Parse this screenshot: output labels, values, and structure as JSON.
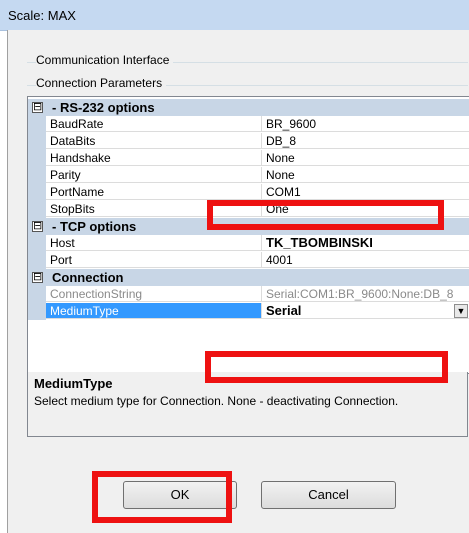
{
  "window": {
    "title": "Scale: MAX"
  },
  "groups": {
    "communication_interface": "Communication Interface",
    "connection_parameters": "Connection Parameters"
  },
  "property_grid": {
    "categories": {
      "rs232": {
        "expander": "⊟",
        "label": "- RS-232 options"
      },
      "tcp": {
        "expander": "⊟",
        "label": "- TCP options"
      },
      "connection": {
        "expander": "⊟",
        "label": "Connection"
      }
    },
    "rs232": [
      {
        "name": "BaudRate",
        "value": "BR_9600"
      },
      {
        "name": "DataBits",
        "value": "DB_8"
      },
      {
        "name": "Handshake",
        "value": "None"
      },
      {
        "name": "Parity",
        "value": "None"
      },
      {
        "name": "PortName",
        "value": "COM1"
      },
      {
        "name": "StopBits",
        "value": "One"
      }
    ],
    "tcp": [
      {
        "name": "Host",
        "value": "TK_TBOMBINSKI"
      },
      {
        "name": "Port",
        "value": "4001"
      }
    ],
    "connection": [
      {
        "name": "ConnectionString",
        "value": "Serial:COM1:BR_9600:None:DB_8"
      },
      {
        "name": "MediumType",
        "value": "Serial"
      }
    ],
    "dropdown_glyph": "▼"
  },
  "help": {
    "title": "MediumType",
    "description": "Select medium type for Connection. None - deactivating Connection."
  },
  "buttons": {
    "ok": "OK",
    "cancel": "Cancel"
  },
  "colors": {
    "annotation": "#ee1111",
    "selected": "#3399ff",
    "category_band": "#c8d6e6"
  }
}
